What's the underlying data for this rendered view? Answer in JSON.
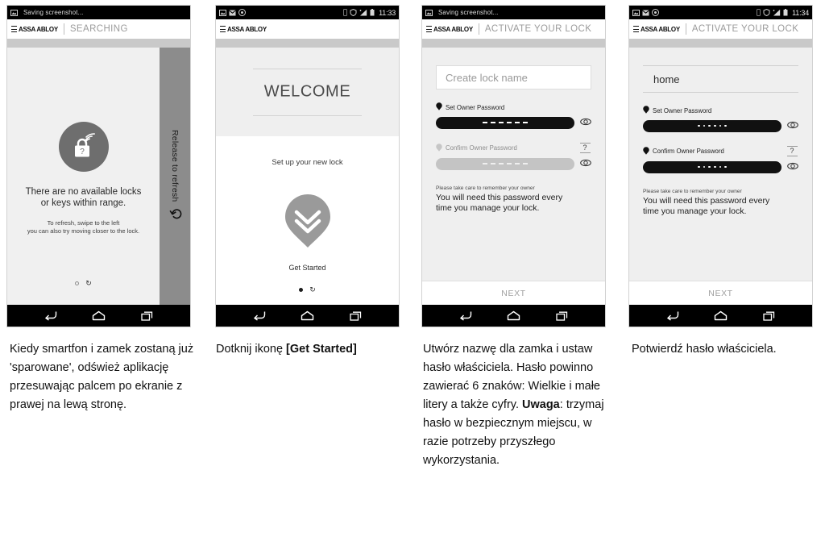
{
  "phones": [
    {
      "id": "phone-searching",
      "statusbar": {
        "notice": "Saving screenshot...",
        "time": ""
      },
      "appbar": {
        "brand": "ASSA ABLOY",
        "title": "SEARCHING"
      },
      "empty_state": {
        "headline_line1": "There are no available locks",
        "headline_line2": "or keys within range.",
        "sub_line1": "To refresh, swipe to the left",
        "sub_line2": "you can also try moving closer to the lock."
      },
      "refresh_panel": {
        "label": "Release to refresh",
        "icon": "refresh-arrow-icon"
      },
      "pager": {
        "dots": [
          "empty",
          "spinner"
        ]
      }
    },
    {
      "id": "phone-welcome",
      "statusbar": {
        "notice": "",
        "time": "11:33"
      },
      "appbar": {
        "brand": "ASSA ABLOY",
        "title": ""
      },
      "welcome": {
        "heading": "WELCOME",
        "subtitle": "Set up your new lock",
        "cta": "Get Started"
      },
      "pager": {
        "dots": [
          "filled",
          "spinner"
        ]
      }
    },
    {
      "id": "phone-activate-empty",
      "statusbar": {
        "notice": "Saving screenshot...",
        "time": ""
      },
      "appbar": {
        "brand": "ASSA ABLOY",
        "title": "ACTIVATE YOUR LOCK"
      },
      "form": {
        "lock_name_value": "",
        "lock_name_placeholder": "Create lock name",
        "set_password_label": "Set Owner Password",
        "confirm_password_label": "Confirm Owner Password",
        "help_mark": "?",
        "set_password_state": "active",
        "confirm_password_state": "inactive",
        "set_password_mask": "dashes",
        "confirm_password_mask": "dashes",
        "mask_count": 6,
        "note_small": "Please take care to remember your owner",
        "note_line1": "You will need this password every",
        "note_line2": "time you manage your lock.",
        "next_label": "NEXT"
      }
    },
    {
      "id": "phone-activate-filled",
      "statusbar": {
        "notice": "",
        "time": "11:34"
      },
      "appbar": {
        "brand": "ASSA ABLOY",
        "title": "ACTIVATE YOUR LOCK"
      },
      "form": {
        "lock_name_value": "home",
        "lock_name_placeholder": "Create lock name",
        "set_password_label": "Set Owner Password",
        "confirm_password_label": "Confirm Owner Password",
        "help_mark": "?",
        "set_password_state": "active",
        "confirm_password_state": "active",
        "set_password_mask": "dots",
        "confirm_password_mask": "dots",
        "mask_count": 6,
        "note_small": "Please take care to remember your owner",
        "note_line1": "You will need this password every",
        "note_line2": "time you manage your lock.",
        "next_label": "NEXT"
      }
    }
  ],
  "captions": {
    "c1": "Kiedy smartfon i zamek zostaną już 'sparowane', odśwież aplikację przesuwając palcem po ekranie z prawej na lewą stronę.",
    "c2_prefix": "Dotknij ikonę ",
    "c2_bold": "[Get Started]",
    "c3_part1": "Utwórz nazwę dla zamka i ustaw hasło właściciela. Hasło powinno zawierać 6 znaków: Wielkie i małe litery a także cyfry. ",
    "c3_bold": "Uwaga",
    "c3_part2": ": trzymaj hasło w bezpiecznym miejscu, w razie potrzeby przyszłego wykorzystania.",
    "c4": "Potwierdź hasło właściciela."
  },
  "icons": {
    "hamburger": "hamburger-icon",
    "back": "back-icon",
    "home": "home-icon",
    "recents": "recents-icon",
    "eye": "eye-icon",
    "pin": "map-pin-icon",
    "lock": "lock-question-icon",
    "chevrons": "double-chevron-down-icon"
  },
  "colors": {
    "page_bg": "#ffffff",
    "screen_bg": "#efefef",
    "statusbar_bg": "#000000",
    "refresh_panel": "#8c8c8c",
    "lock_badge": "#6e6e6e",
    "pin": "#9a9a9a",
    "field_active": "#111111",
    "field_inactive": "#c4c4c4",
    "muted_text": "#9b9b9b"
  }
}
